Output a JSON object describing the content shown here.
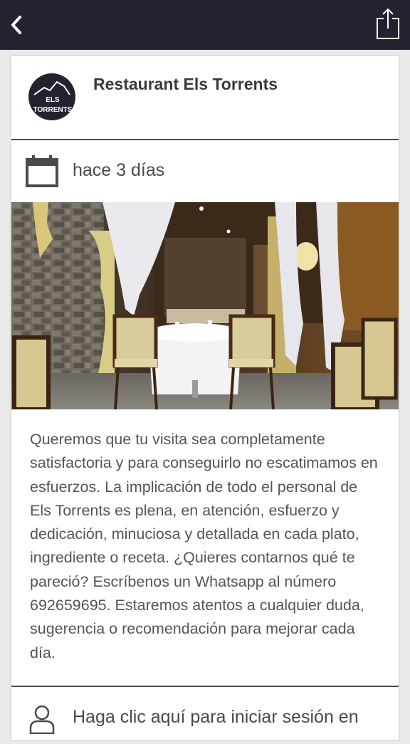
{
  "topbar": {
    "back_icon": "chevron-left-icon",
    "share_icon": "share-icon",
    "background": "#25222f"
  },
  "header": {
    "title": "Restaurant Els Torrents",
    "logo_line1": "ELS",
    "logo_line2": "TORRENTS"
  },
  "post": {
    "date_icon": "calendar-icon",
    "date_text": "hace 3 días",
    "photo_alt": "restaurant-interior-photo",
    "description": "Queremos que tu visita sea completamente satisfactoria y para conseguirlo no escatimamos en esfuerzos. La implicación de todo el personal de Els Torrents es plena, en atención, esfuerzo y dedicación, minuciosa y detallada en cada plato, ingrediente o receta. ¿Quieres contarnos qué te pareció? Escríbenos un Whatsapp al número 692659695. Estaremos atentos a cualquier duda, sugerencia o recomendación para mejorar cada día."
  },
  "login": {
    "icon": "user-icon",
    "text": "Haga clic aquí para iniciar sesión en"
  }
}
